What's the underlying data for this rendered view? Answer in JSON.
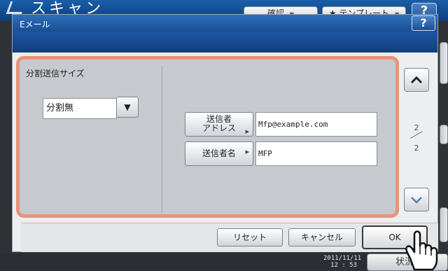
{
  "background_screen": {
    "title": "スキャン",
    "tabs": [
      {
        "label": "確認"
      },
      {
        "label": "★ テンプレート"
      }
    ],
    "help_label": "?",
    "clock": {
      "date": "2011/11/11",
      "time": "12 : 53"
    },
    "status_label": "状況"
  },
  "dialog": {
    "title": "Eメール",
    "help_label": "?",
    "split_section": {
      "label": "分割送信サイズ",
      "selected": "分割無"
    },
    "fields": [
      {
        "button_label_line1": "送信者",
        "button_label_line2": "アドレス",
        "value": "Mfp@example.com"
      },
      {
        "button_label_line1": "送信者名",
        "button_label_line2": "",
        "value": "MFP"
      }
    ],
    "pager": {
      "current": "2",
      "total": "2"
    },
    "actions": {
      "reset": "リセット",
      "cancel": "キャンセル",
      "ok": "OK"
    }
  },
  "colors": {
    "title_blue": "#1a4f95",
    "highlight_border": "#e8937a",
    "panel_gray": "#c6cace"
  }
}
